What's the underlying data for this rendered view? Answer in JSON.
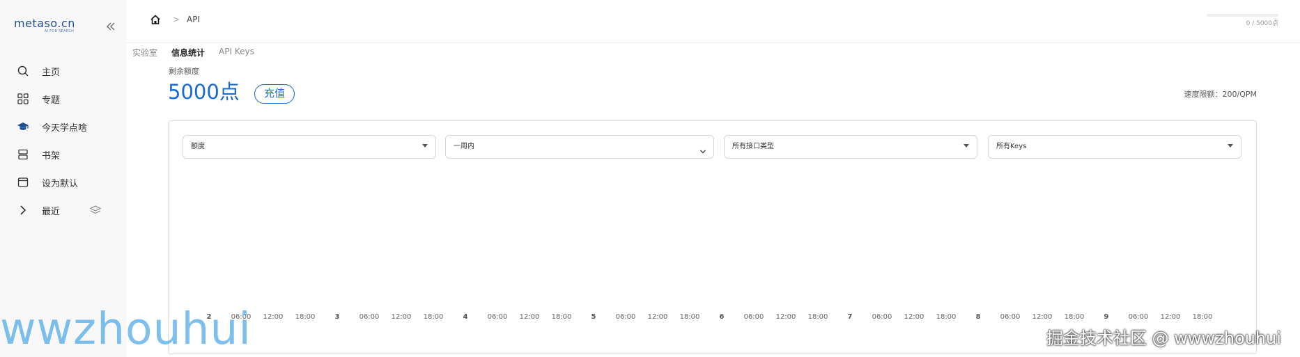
{
  "sidebar": {
    "logo_text": "metaso.cn",
    "logo_sub": "AI FOR SEARCH",
    "items": [
      {
        "label": "主页",
        "icon": "search-icon"
      },
      {
        "label": "专题",
        "icon": "grid-icon"
      },
      {
        "label": "今天学点啥",
        "icon": "graduation-cap-icon"
      },
      {
        "label": "书架",
        "icon": "bookshelf-icon"
      },
      {
        "label": "设为默认",
        "icon": "window-icon"
      },
      {
        "label": "最近",
        "icon": "chevron-right-icon",
        "trail_icon": "layers-icon"
      }
    ]
  },
  "topbar": {
    "breadcrumb_current": "API",
    "breadcrumb_separator": ">",
    "quota_text": "0 / 5000点",
    "quota_used_fraction": 0
  },
  "tabs": [
    {
      "label": "实验室",
      "active": false
    },
    {
      "label": "信息统计",
      "active": true
    },
    {
      "label": "API Keys",
      "active": false
    }
  ],
  "summary": {
    "remaining_label": "剩余额度",
    "points": "5000点",
    "recharge_label": "充值",
    "rate_limit": "速度限额：200/QPM"
  },
  "filters": [
    {
      "value": "额度"
    },
    {
      "value": "一周内"
    },
    {
      "value": "所有接口类型"
    },
    {
      "value": "所有Keys"
    }
  ],
  "chart_data": {
    "type": "line",
    "series": [],
    "x_tick_labels": [
      "2",
      "06:00",
      "12:00",
      "18:00",
      "3",
      "06:00",
      "12:00",
      "18:00",
      "4",
      "06:00",
      "12:00",
      "18:00",
      "5",
      "06:00",
      "12:00",
      "18:00",
      "6",
      "06:00",
      "12:00",
      "18:00",
      "7",
      "06:00",
      "12:00",
      "18:00",
      "8",
      "06:00",
      "12:00",
      "18:00",
      "9",
      "06:00",
      "12:00",
      "18:00"
    ]
  },
  "watermarks": {
    "left": "wwzhouhui",
    "right": "掘金技术社区 @ wwwzhouhui"
  },
  "colors": {
    "accent": "#1a6bd0",
    "sidebar_bg": "#f8f8f9",
    "watermark_blue": "#5aaee8"
  }
}
